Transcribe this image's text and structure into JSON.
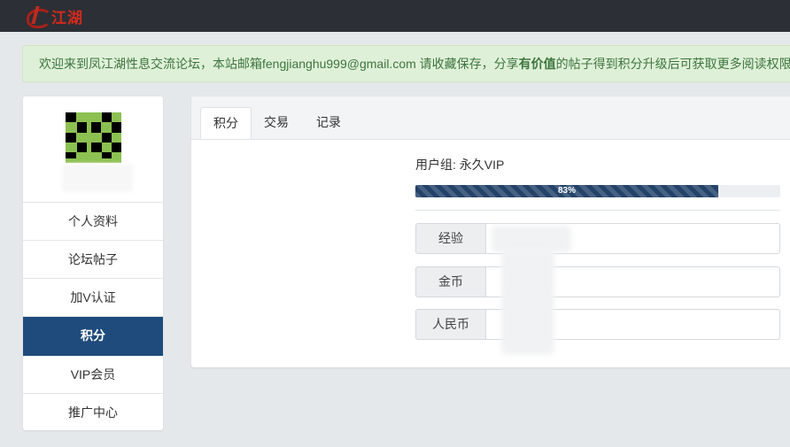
{
  "header": {
    "logo_text": "江湖"
  },
  "notice": {
    "text_before": "欢迎来到凤江湖性息交流论坛，本站邮箱fengjianghu999@gmail.com 请收藏保存，分享",
    "bold": "有价值",
    "text_after": "的帖子得到积分升级后可获取更多阅读权限"
  },
  "sidebar": {
    "items": [
      {
        "label": "个人资料"
      },
      {
        "label": "论坛帖子"
      },
      {
        "label": "加V认证"
      },
      {
        "label": "积分",
        "active": true
      },
      {
        "label": "VIP会员"
      },
      {
        "label": "推广中心"
      }
    ]
  },
  "tabs": [
    {
      "label": "积分",
      "active": true
    },
    {
      "label": "交易"
    },
    {
      "label": "记录"
    }
  ],
  "points": {
    "usergroup": "用户组: 永久VIP",
    "progress_label": "83%",
    "progress_value": 0.83,
    "fields": [
      {
        "label": "经验"
      },
      {
        "label": "金币"
      },
      {
        "label": "人民币"
      }
    ]
  },
  "colors": {
    "topbar": "#2c2f35",
    "accent": "#1f4b7c",
    "notice_bg": "#dff0d8",
    "notice_text": "#3c763d",
    "logo_red": "#d42a1d"
  }
}
